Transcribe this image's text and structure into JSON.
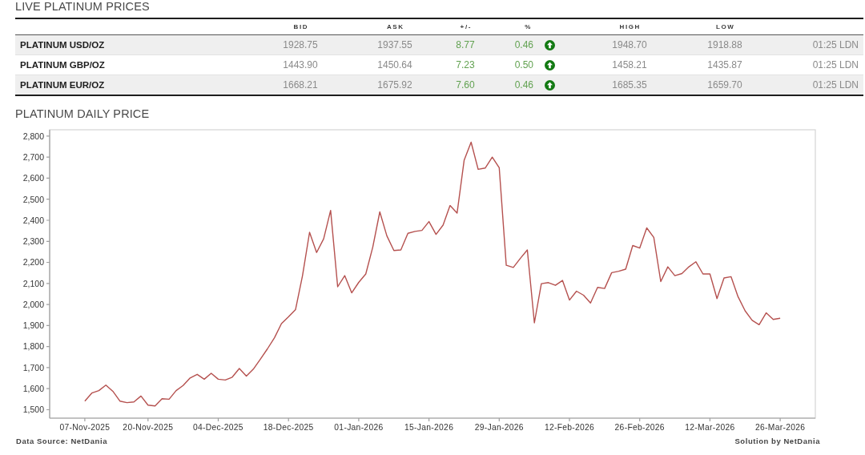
{
  "live_prices": {
    "title": "LIVE PLATINUM PRICES",
    "columns": {
      "bid": "BID",
      "ask": "ASK",
      "change": "+/-",
      "percent": "%",
      "high": "HIGH",
      "low": "LOW"
    },
    "rows": [
      {
        "name": "PLATINUM USD/OZ",
        "bid": "1928.75",
        "ask": "1937.55",
        "change": "8.77",
        "percent": "0.46",
        "rising": true,
        "high": "1948.70",
        "low": "1918.88",
        "time": "01:25 LDN"
      },
      {
        "name": "PLATINUM GBP/OZ",
        "bid": "1443.90",
        "ask": "1450.64",
        "change": "7.23",
        "percent": "0.50",
        "rising": true,
        "high": "1458.21",
        "low": "1435.87",
        "time": "01:25 LDN"
      },
      {
        "name": "PLATINUM EUR/OZ",
        "bid": "1668.21",
        "ask": "1675.92",
        "change": "7.60",
        "percent": "0.46",
        "rising": true,
        "high": "1685.35",
        "low": "1659.70",
        "time": "01:25 LDN"
      }
    ]
  },
  "chart": {
    "chart_data": {
      "type": "line",
      "title": "PLATINUM DAILY PRICE",
      "ylim": [
        1460,
        2830
      ],
      "yticks": [
        {
          "value": 1500,
          "label": "1,500"
        },
        {
          "value": 1600,
          "label": "1,600"
        },
        {
          "value": 1700,
          "label": "1,700"
        },
        {
          "value": 1800,
          "label": "1,800"
        },
        {
          "value": 1900,
          "label": "1,900"
        },
        {
          "value": 2000,
          "label": "2,000"
        },
        {
          "value": 2100,
          "label": "2,100"
        },
        {
          "value": 2200,
          "label": "2,200"
        },
        {
          "value": 2300,
          "label": "2,300"
        },
        {
          "value": 2400,
          "label": "2,400"
        },
        {
          "value": 2500,
          "label": "2,500"
        },
        {
          "value": 2600,
          "label": "2,600"
        },
        {
          "value": 2700,
          "label": "2,700"
        },
        {
          "value": 2800,
          "label": "2,800"
        }
      ],
      "categories": [
        "07-Nov-2025",
        null,
        null,
        null,
        null,
        null,
        null,
        null,
        null,
        "20-Nov-2025",
        null,
        null,
        null,
        null,
        null,
        null,
        null,
        null,
        null,
        "04-Dec-2025",
        null,
        null,
        null,
        null,
        null,
        null,
        null,
        null,
        null,
        "18-Dec-2025",
        null,
        null,
        null,
        null,
        null,
        null,
        null,
        null,
        null,
        "01-Jan-2026",
        null,
        null,
        null,
        null,
        null,
        null,
        null,
        null,
        null,
        "15-Jan-2026",
        null,
        null,
        null,
        null,
        null,
        null,
        null,
        null,
        null,
        "29-Jan-2026",
        null,
        null,
        null,
        null,
        null,
        null,
        null,
        null,
        null,
        "12-Feb-2026",
        null,
        null,
        null,
        null,
        null,
        null,
        null,
        null,
        null,
        "26-Feb-2026",
        null,
        null,
        null,
        null,
        null,
        null,
        null,
        null,
        null,
        "12-Mar-2026",
        null,
        null,
        null,
        null,
        null,
        null,
        null,
        null,
        null,
        "26-Mar-2026"
      ],
      "values": [
        1541,
        1579,
        1591,
        1617,
        1588,
        1541,
        1534,
        1537,
        1565,
        1522,
        1518,
        1552,
        1550,
        1591,
        1615,
        1651,
        1668,
        1645,
        1673,
        1645,
        1641,
        1655,
        1696,
        1660,
        1693,
        1740,
        1789,
        1842,
        1909,
        1941,
        1976,
        2137,
        2343,
        2247,
        2312,
        2447,
        2084,
        2137,
        2055,
        2105,
        2145,
        2272,
        2440,
        2326,
        2256,
        2259,
        2338,
        2347,
        2352,
        2394,
        2333,
        2377,
        2470,
        2434,
        2685,
        2771,
        2642,
        2648,
        2700,
        2650,
        2186,
        2176,
        2219,
        2259,
        1913,
        2099,
        2104,
        2091,
        2114,
        2021,
        2063,
        2044,
        2007,
        2081,
        2076,
        2151,
        2158,
        2168,
        2280,
        2268,
        2364,
        2319,
        2109,
        2179,
        2137,
        2147,
        2179,
        2203,
        2145,
        2145,
        2028,
        2126,
        2132,
        2037,
        1970,
        1925,
        1904,
        1960,
        1929,
        1935
      ]
    },
    "source": "Data Source: NetDania",
    "credit": "Solution by NetDania"
  }
}
